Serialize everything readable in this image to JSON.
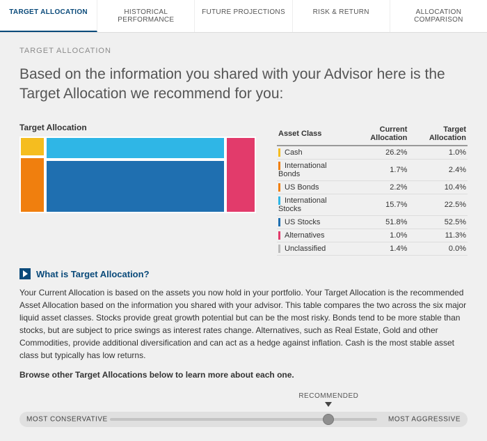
{
  "tabs": {
    "items": [
      "TARGET ALLOCATION",
      "HISTORICAL PERFORMANCE",
      "FUTURE PROJECTIONS",
      "RISK & RETURN",
      "ALLOCATION COMPARISON"
    ]
  },
  "section_label": "TARGET ALLOCATION",
  "lead": "Based on the information you shared with your Advisor here is the Target Allocation we recommend for you:",
  "chart_title": "Target Allocation",
  "table": {
    "headers": {
      "c0": "Asset Class",
      "c1": "Current Allocation",
      "c2": "Target Allocation"
    }
  },
  "rows": [
    {
      "name": "Cash",
      "current": "26.2%",
      "target": "1.0%",
      "color": "#f5bd1f"
    },
    {
      "name": "International Bonds",
      "current": "1.7%",
      "target": "2.4%",
      "color": "#f07f0e"
    },
    {
      "name": "US Bonds",
      "current": "2.2%",
      "target": "10.4%",
      "color": "#f07f0e"
    },
    {
      "name": "International Stocks",
      "current": "15.7%",
      "target": "22.5%",
      "color": "#2fb6e6"
    },
    {
      "name": "US Stocks",
      "current": "51.8%",
      "target": "52.5%",
      "color": "#1f6fb0"
    },
    {
      "name": "Alternatives",
      "current": "1.0%",
      "target": "11.3%",
      "color": "#e23b6b"
    },
    {
      "name": "Unclassified",
      "current": "1.4%",
      "target": "0.0%",
      "color": "#bbbbbb"
    }
  ],
  "expander_label": "What is Target Allocation?",
  "description": "Your Current Allocation is based on the assets you now hold in your portfolio. Your Target Allocation is the recommended Asset Allocation based on the information you shared with your advisor. This table compares the two across the six major liquid asset classes. Stocks provide great growth potential but can be the most risky. Bonds tend to be more stable than stocks, but are subject to price swings as interest rates change. Alternatives, such as Real Estate, Gold and other Commodities, provide additional diversification and can act as a hedge against inflation. Cash is the most stable asset class but typically has low returns.",
  "browse_prompt": "Browse other Target Allocations below to learn more about each one.",
  "slider": {
    "left_label": "MOST CONSERVATIVE",
    "right_label": "MOST AGGRESSIVE",
    "recommended_label": "RECOMMENDED"
  },
  "chart_data": {
    "type": "table",
    "title": "Target Allocation",
    "columns": [
      "Asset Class",
      "Current Allocation (%)",
      "Target Allocation (%)"
    ],
    "rows": [
      [
        "Cash",
        26.2,
        1.0
      ],
      [
        "International Bonds",
        1.7,
        2.4
      ],
      [
        "US Bonds",
        2.2,
        10.4
      ],
      [
        "International Stocks",
        15.7,
        22.5
      ],
      [
        "US Stocks",
        51.8,
        52.5
      ],
      [
        "Alternatives",
        1.0,
        11.3
      ],
      [
        "Unclassified",
        1.4,
        0.0
      ]
    ],
    "secondary": {
      "type": "treemap",
      "title": "Target Allocation",
      "series": [
        {
          "name": "Cash",
          "value": 1.0
        },
        {
          "name": "International Bonds",
          "value": 2.4
        },
        {
          "name": "US Bonds",
          "value": 10.4
        },
        {
          "name": "International Stocks",
          "value": 22.5
        },
        {
          "name": "US Stocks",
          "value": 52.5
        },
        {
          "name": "Alternatives",
          "value": 11.3
        },
        {
          "name": "Unclassified",
          "value": 0.0
        }
      ]
    }
  }
}
